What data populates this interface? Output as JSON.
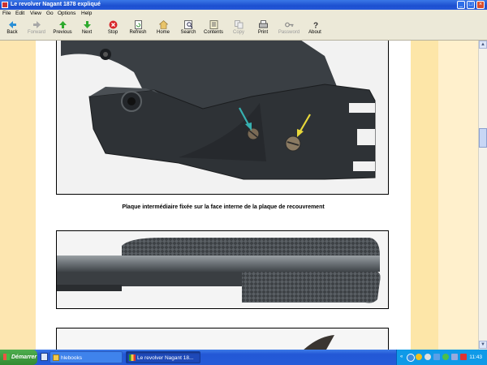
{
  "window": {
    "title": "Le revolver Nagant 1878 expliqué"
  },
  "menu": [
    "File",
    "Edit",
    "View",
    "Go",
    "Options",
    "Help"
  ],
  "toolbar": {
    "back": "Back",
    "forward": "Forward",
    "previous": "Previous",
    "next": "Next",
    "stop": "Stop",
    "refresh": "Refresh",
    "home": "Home",
    "search": "Search",
    "contents": "Contents",
    "copy": "Copy",
    "print": "Print",
    "password": "Password",
    "about": "About"
  },
  "content": {
    "caption": "Plaque intermédiaire fixée sur la face interne de la plaque de recouvrement"
  },
  "taskbar": {
    "start": "Démarrer",
    "tasks": [
      "hlebooks",
      "Le revolver Nagant 18..."
    ],
    "active_task": "Le revolver Nagant 18...",
    "clock": "11:43"
  },
  "colors": {
    "title_blue": "#2458d8",
    "page_band": "#fde6b0",
    "start_green": "#318a31"
  },
  "icons": [
    "back-icon",
    "forward-icon",
    "previous-icon",
    "next-icon",
    "stop-icon",
    "refresh-icon",
    "home-icon",
    "search-icon",
    "contents-icon",
    "copy-icon",
    "print-icon",
    "password-icon",
    "about-icon"
  ]
}
